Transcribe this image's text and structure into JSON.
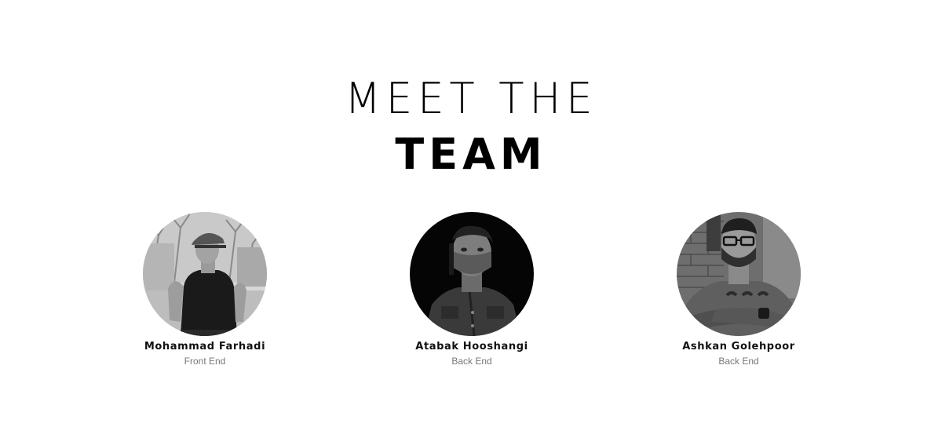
{
  "heading": {
    "line1": "MEET THE",
    "line2": "TEAM"
  },
  "members": [
    {
      "name": "Mohammad Farhadi",
      "role": "Front End",
      "photo_icon": "portrait-photo"
    },
    {
      "name": "Atabak Hooshangi",
      "role": "Back End",
      "photo_icon": "portrait-photo"
    },
    {
      "name": "Ashkan Golehpoor",
      "role": "Back End",
      "photo_icon": "portrait-photo"
    }
  ]
}
